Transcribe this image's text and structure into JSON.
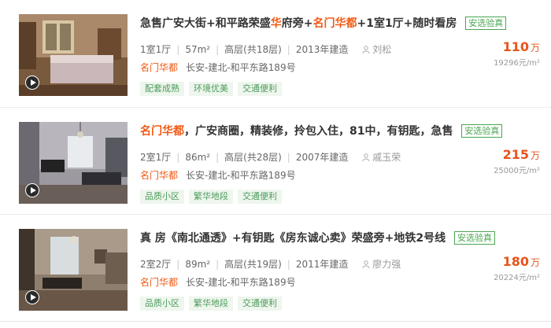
{
  "listings": [
    {
      "title_parts": [
        {
          "text": "急售广安大街+和平路荣盛",
          "hl": false
        },
        {
          "text": "华",
          "hl": true
        },
        {
          "text": "府旁+",
          "hl": false
        },
        {
          "text": "名门华都",
          "hl": true
        },
        {
          "text": "+1室1厅+随时看房",
          "hl": false
        }
      ],
      "verify_tag": "安选验真",
      "layout": "1室1厅",
      "area": "57m²",
      "floor": "高层(共18层)",
      "year": "2013年建造",
      "agent": "刘松",
      "community": "名门华都",
      "address": "长安-建北-和平东路189号",
      "tags": [
        "配套成熟",
        "环境优美",
        "交通便利"
      ],
      "price": "110",
      "price_unit": "万",
      "unit_price": "19296元/m²"
    },
    {
      "title_parts": [
        {
          "text": "名门华都",
          "hl": true
        },
        {
          "text": "，广安商圈，精装修，拎包入住，81中，有钥匙，急售",
          "hl": false
        }
      ],
      "verify_tag": "安选验真",
      "layout": "2室1厅",
      "area": "86m²",
      "floor": "高层(共28层)",
      "year": "2007年建造",
      "agent": "戚玉荣",
      "community": "名门华都",
      "address": "长安-建北-和平东路189号",
      "tags": [
        "品质小区",
        "繁华地段",
        "交通便利"
      ],
      "price": "215",
      "price_unit": "万",
      "unit_price": "25000元/m²"
    },
    {
      "title_parts": [
        {
          "text": "真 房《南北通透》+有钥匙《房东诚心卖》荣盛旁+地铁2号线",
          "hl": false
        }
      ],
      "verify_tag": "安选验真",
      "layout": "2室2厅",
      "area": "89m²",
      "floor": "高层(共19层)",
      "year": "2011年建造",
      "agent": "廖力强",
      "community": "名门华都",
      "address": "长安-建北-和平东路189号",
      "tags": [
        "品质小区",
        "繁华地段",
        "交通便利"
      ],
      "price": "180",
      "price_unit": "万",
      "unit_price": "20224元/m²"
    }
  ]
}
